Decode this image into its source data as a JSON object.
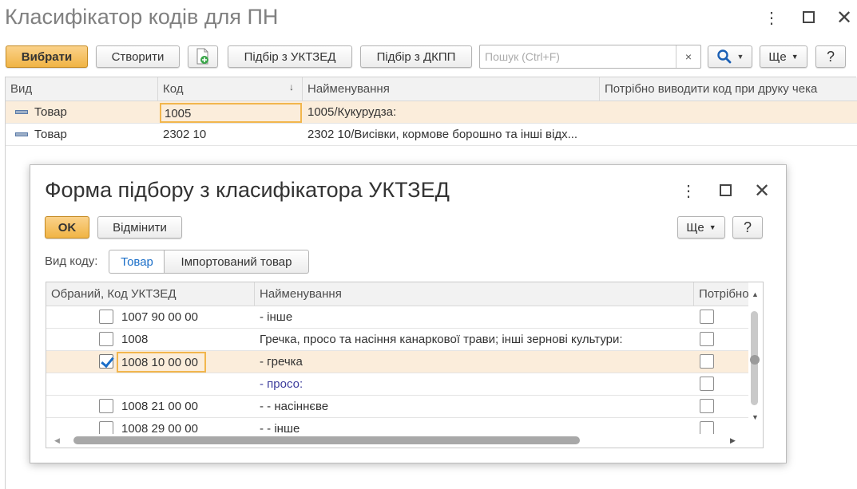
{
  "window": {
    "title": "Класифікатор кодів для ПН"
  },
  "toolbar": {
    "select_label": "Вибрати",
    "create_label": "Створити",
    "uktzed_label": "Підбір з УКТЗЕД",
    "dkpp_label": "Підбір з ДКПП",
    "search_placeholder": "Пошук (Ctrl+F)",
    "clear_label": "×",
    "more_label": "Ще",
    "help_label": "?"
  },
  "grid": {
    "columns": [
      "Вид",
      "Код",
      "Найменування",
      "Потрібно виводити код при друку чека"
    ],
    "sort_indicator": "↓",
    "rows": [
      {
        "kind": "Товар",
        "code": "1005",
        "name": "1005/Кукурудза:",
        "selected": true
      },
      {
        "kind": "Товар",
        "code": "2302 10",
        "name": "2302 10/Висівки, кормове борошно та інші відх...",
        "selected": false
      }
    ]
  },
  "dialog": {
    "title": "Форма підбору з класифікатора УКТЗЕД",
    "ok_label": "OK",
    "cancel_label": "Відмінити",
    "more_label": "Ще",
    "help_label": "?",
    "code_kind_label": "Вид коду:",
    "code_kind_options": [
      "Товар",
      "Імпортований товар"
    ],
    "code_kind_selected": "Товар",
    "columns": [
      "Обраний, Код УКТЗЕД",
      "Найменування",
      "Потрібно"
    ],
    "rows": [
      {
        "checked": false,
        "show_check": true,
        "code": "1007 90 00 00",
        "name": "- інше",
        "selected": false,
        "group": false
      },
      {
        "checked": false,
        "show_check": true,
        "code": "1008",
        "name": "Гречка, просо та насіння канаркової трави; інші зернові культури:",
        "selected": false,
        "group": false
      },
      {
        "checked": true,
        "show_check": true,
        "code": "1008 10 00 00",
        "name": "- гречка",
        "selected": true,
        "group": false
      },
      {
        "checked": false,
        "show_check": false,
        "code": "",
        "name": "- просо:",
        "selected": false,
        "group": true
      },
      {
        "checked": false,
        "show_check": true,
        "code": "1008 21 00 00",
        "name": "- - насіннєве",
        "selected": false,
        "group": false
      },
      {
        "checked": false,
        "show_check": true,
        "code": "1008 29 00 00",
        "name": "- - інше",
        "selected": false,
        "group": false
      }
    ]
  },
  "colors": {
    "accent": "#f0b445",
    "selection": "#fbeddb",
    "focus": "#f2b64d",
    "link": "#1a6ec8"
  }
}
